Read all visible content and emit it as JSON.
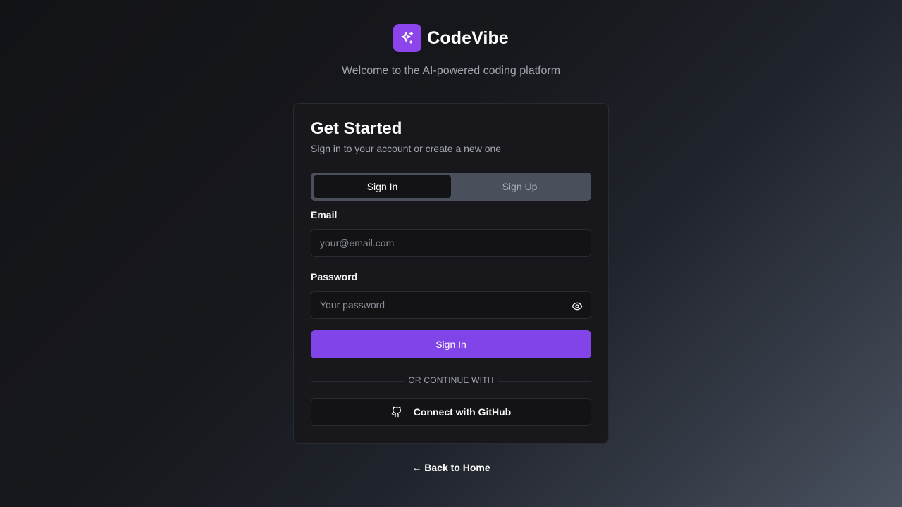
{
  "brand": {
    "name": "CodeVibe",
    "tagline": "Welcome to the AI-powered coding platform",
    "logo_icon": "sparkles-icon",
    "accent_color": "#8b45ea"
  },
  "card": {
    "title": "Get Started",
    "subtitle": "Sign in to your account or create a new one",
    "tabs": [
      {
        "label": "Sign In",
        "active": true
      },
      {
        "label": "Sign Up",
        "active": false
      }
    ],
    "email": {
      "label": "Email",
      "value": "",
      "placeholder": "your@email.com"
    },
    "password": {
      "label": "Password",
      "value": "",
      "placeholder": "Your password",
      "toggle_icon": "eye-icon"
    },
    "submit_label": "Sign In",
    "divider_text": "OR CONTINUE WITH",
    "github": {
      "label": "Connect with GitHub",
      "icon": "github-icon"
    }
  },
  "footer": {
    "back_link": "← Back to Home"
  },
  "colors": {
    "primary_button": "#8144e8",
    "card_background": "#18181c",
    "page_background_dark": "#121317",
    "page_background_light": "#4a5260"
  }
}
